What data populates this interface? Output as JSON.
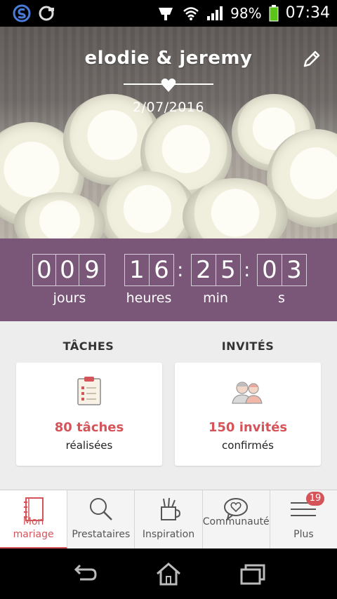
{
  "status_bar": {
    "battery": "98%",
    "time": "07:34",
    "icons": [
      "app-s-icon",
      "sd-icon",
      "usb-icon",
      "wifi-icon",
      "signal-icon",
      "battery-icon"
    ]
  },
  "hero": {
    "title": "elodie & jeremy",
    "date": "2/07/2016",
    "edit_icon": "pencil-icon"
  },
  "countdown": {
    "days": [
      "0",
      "0",
      "9"
    ],
    "hours": [
      "1",
      "6"
    ],
    "minutes": [
      "2",
      "5"
    ],
    "seconds": [
      "0",
      "3"
    ],
    "labels": {
      "days": "jours",
      "hours": "heures",
      "minutes": "min",
      "seconds": "s"
    },
    "bg_color": "#7a5679"
  },
  "summary": {
    "tasks": {
      "title": "TÂCHES",
      "count": "80 tâches",
      "sub": "réalisées",
      "icon": "clipboard-icon"
    },
    "guests": {
      "title": "INVITÉS",
      "count": "150 invités",
      "sub": "confirmés",
      "icon": "guests-icon"
    },
    "accent_color": "#d5545a"
  },
  "bottom_nav": {
    "items": [
      {
        "label": "Mon mariage",
        "icon": "notebook-icon",
        "active": true
      },
      {
        "label": "Prestataires",
        "icon": "search-icon"
      },
      {
        "label": "Inspiration",
        "icon": "pencil-cup-icon"
      },
      {
        "label": "Communauté",
        "icon": "chat-heart-icon"
      },
      {
        "label": "Plus",
        "icon": "menu-icon",
        "badge": "19"
      }
    ]
  },
  "system_nav": [
    "back-icon",
    "home-icon",
    "recents-icon"
  ]
}
